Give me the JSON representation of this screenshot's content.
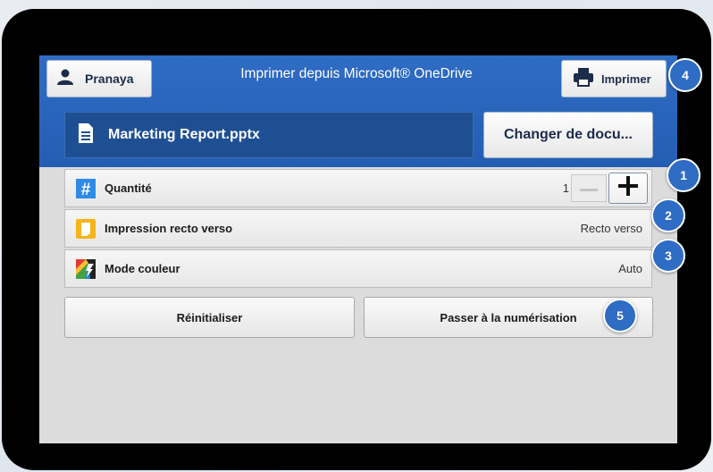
{
  "header": {
    "user_label": "Pranaya",
    "title": "Imprimer depuis Microsoft® OneDrive",
    "print_label": "Imprimer"
  },
  "document": {
    "name": "Marketing Report.pptx",
    "change_label": "Changer de docu..."
  },
  "settings": {
    "quantity": {
      "label": "Quantité",
      "value": "1"
    },
    "duplex": {
      "label": "Impression recto verso",
      "value": "Recto verso"
    },
    "color_mode": {
      "label": "Mode couleur",
      "value": "Auto"
    }
  },
  "actions": {
    "reset_label": "Réinitialiser",
    "scan_label": "Passer à la numérisation"
  },
  "callouts": [
    "1",
    "2",
    "3",
    "4",
    "5"
  ],
  "icons": {
    "user": "user-icon",
    "printer": "printer-icon",
    "document": "document-icon",
    "quantity": "hash-icon",
    "duplex": "duplex-icon",
    "color": "color-mode-icon"
  },
  "colors": {
    "header_blue": "#2f6cc4",
    "doc_field": "#1f4f93",
    "badge_blue": "#2f6cc4",
    "hash_icon": "#2e8be6",
    "duplex_icon": "#f4b41a"
  }
}
